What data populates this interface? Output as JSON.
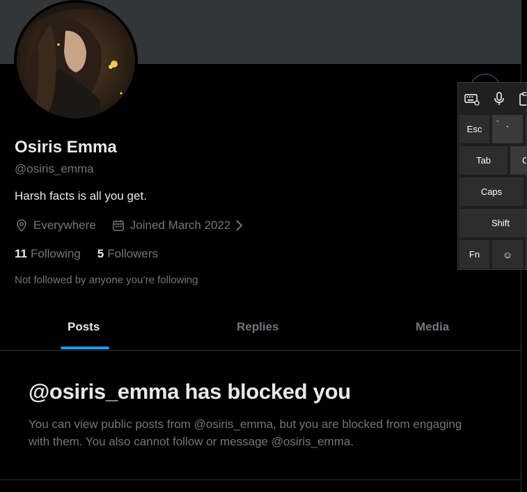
{
  "profile": {
    "name": "Osiris Emma",
    "handle": "@osiris_emma",
    "bio": "Harsh facts is all you get.",
    "location": "Everywhere",
    "joined": "Joined March 2022",
    "following_count": "11",
    "following_label": "Following",
    "followers_count": "5",
    "followers_label": "Followers",
    "not_followed_note": "Not followed by anyone you’re following"
  },
  "tabs": [
    {
      "label": "Posts",
      "active": true
    },
    {
      "label": "Replies",
      "active": false
    },
    {
      "label": "Media",
      "active": false
    }
  ],
  "blocked": {
    "title": "@osiris_emma has blocked you",
    "body": "You can view public posts from @osiris_emma, but you are blocked from engaging with them. You also cannot follow or message @osiris_emma."
  },
  "keyboard": {
    "toolbar_icons": [
      "keyboard-settings-icon",
      "microphone-icon",
      "clipboard-icon"
    ],
    "keys": {
      "esc": "Esc",
      "tilde_small": "~",
      "tilde_big": "`",
      "tab": "Tab",
      "q_partial": "C",
      "caps": "Caps",
      "shift": "Shift",
      "fn": "Fn",
      "emoji": "☺"
    }
  },
  "colors": {
    "accent": "#1d9bf0",
    "text_primary": "#e7e9ea",
    "text_secondary": "#71767b",
    "banner": "#333639",
    "divider": "#2f3336"
  }
}
